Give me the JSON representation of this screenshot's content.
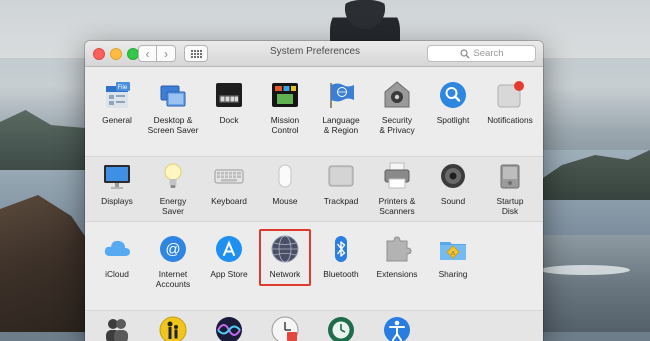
{
  "window": {
    "title": "System Preferences",
    "search_placeholder": "Search",
    "back_glyph": "‹",
    "forward_glyph": "›"
  },
  "accent_colors": {
    "highlight_box": "#e0382d",
    "close": "#fc605c",
    "minimize": "#fdbc40",
    "maximize": "#34c84a"
  },
  "rows": [
    [
      {
        "label": "General",
        "icon": "general-icon"
      },
      {
        "label": "Desktop &\nScreen Saver",
        "icon": "desktop-icon"
      },
      {
        "label": "Dock",
        "icon": "dock-icon"
      },
      {
        "label": "Mission\nControl",
        "icon": "mission-control-icon"
      },
      {
        "label": "Language\n& Region",
        "icon": "language-region-icon"
      },
      {
        "label": "Security\n& Privacy",
        "icon": "security-icon"
      },
      {
        "label": "Spotlight",
        "icon": "spotlight-icon"
      },
      {
        "label": "Notifications",
        "icon": "notifications-icon"
      }
    ],
    [
      {
        "label": "Displays",
        "icon": "displays-icon"
      },
      {
        "label": "Energy\nSaver",
        "icon": "energy-saver-icon"
      },
      {
        "label": "Keyboard",
        "icon": "keyboard-icon"
      },
      {
        "label": "Mouse",
        "icon": "mouse-icon"
      },
      {
        "label": "Trackpad",
        "icon": "trackpad-icon"
      },
      {
        "label": "Printers &\nScanners",
        "icon": "printer-icon"
      },
      {
        "label": "Sound",
        "icon": "sound-icon"
      },
      {
        "label": "Startup\nDisk",
        "icon": "startup-disk-icon"
      }
    ],
    [
      {
        "label": "iCloud",
        "icon": "icloud-icon"
      },
      {
        "label": "Internet\nAccounts",
        "icon": "internet-accounts-icon"
      },
      {
        "label": "App Store",
        "icon": "app-store-icon"
      },
      {
        "label": "Network",
        "icon": "network-icon",
        "highlighted": true
      },
      {
        "label": "Bluetooth",
        "icon": "bluetooth-icon"
      },
      {
        "label": "Extensions",
        "icon": "extensions-icon"
      },
      {
        "label": "Sharing",
        "icon": "sharing-icon"
      }
    ],
    [
      {
        "label": "",
        "icon": "users-groups-icon"
      },
      {
        "label": "",
        "icon": "parental-controls-icon"
      },
      {
        "label": "",
        "icon": "siri-icon"
      },
      {
        "label": "",
        "icon": "date-time-icon"
      },
      {
        "label": "",
        "icon": "time-machine-icon"
      },
      {
        "label": "",
        "icon": "accessibility-icon"
      }
    ]
  ]
}
